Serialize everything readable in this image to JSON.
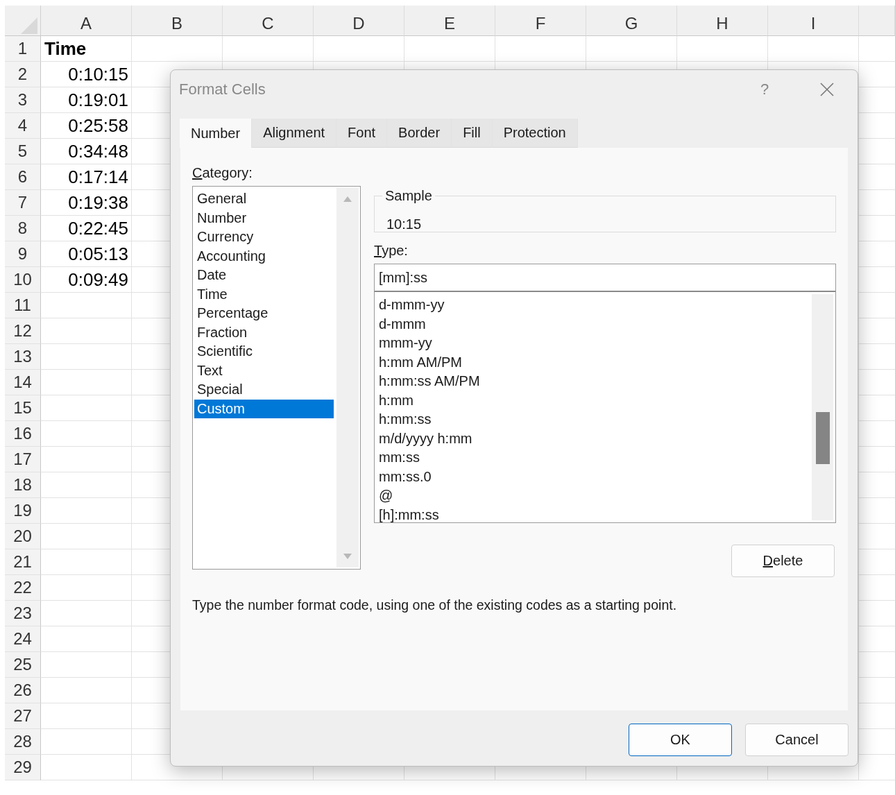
{
  "sheet": {
    "columns": [
      "A",
      "B",
      "C",
      "D",
      "E",
      "F",
      "G",
      "H",
      "I"
    ],
    "rows": [
      {
        "number": "1",
        "cell_a": {
          "text": "Time",
          "bold": true
        }
      },
      {
        "number": "2",
        "cell_a": {
          "text": "0:10:15",
          "bold": false
        }
      },
      {
        "number": "3",
        "cell_a": {
          "text": "0:19:01",
          "bold": false
        }
      },
      {
        "number": "4",
        "cell_a": {
          "text": "0:25:58",
          "bold": false
        }
      },
      {
        "number": "5",
        "cell_a": {
          "text": "0:34:48",
          "bold": false
        }
      },
      {
        "number": "6",
        "cell_a": {
          "text": "0:17:14",
          "bold": false
        }
      },
      {
        "number": "7",
        "cell_a": {
          "text": "0:19:38",
          "bold": false
        }
      },
      {
        "number": "8",
        "cell_a": {
          "text": "0:22:45",
          "bold": false
        }
      },
      {
        "number": "9",
        "cell_a": {
          "text": "0:05:13",
          "bold": false
        }
      },
      {
        "number": "10",
        "cell_a": {
          "text": "0:09:49",
          "bold": false
        }
      },
      {
        "number": "11"
      },
      {
        "number": "12"
      },
      {
        "number": "13"
      },
      {
        "number": "14"
      },
      {
        "number": "15"
      },
      {
        "number": "16"
      },
      {
        "number": "17"
      },
      {
        "number": "18"
      },
      {
        "number": "19"
      },
      {
        "number": "20"
      },
      {
        "number": "21"
      },
      {
        "number": "22"
      },
      {
        "number": "23"
      },
      {
        "number": "24"
      },
      {
        "number": "25"
      },
      {
        "number": "26"
      },
      {
        "number": "27"
      },
      {
        "number": "28"
      },
      {
        "number": "29"
      }
    ]
  },
  "dialog": {
    "title": "Format Cells",
    "help": "?",
    "tabs": [
      {
        "label": "Number",
        "selected": true
      },
      {
        "label": "Alignment",
        "selected": false
      },
      {
        "label": "Font",
        "selected": false
      },
      {
        "label": "Border",
        "selected": false
      },
      {
        "label": "Fill",
        "selected": false
      },
      {
        "label": "Protection",
        "selected": false
      }
    ],
    "category": {
      "label": "Category:",
      "items": [
        {
          "label": "General",
          "selected": false
        },
        {
          "label": "Number",
          "selected": false
        },
        {
          "label": "Currency",
          "selected": false
        },
        {
          "label": "Accounting",
          "selected": false
        },
        {
          "label": "Date",
          "selected": false
        },
        {
          "label": "Time",
          "selected": false
        },
        {
          "label": "Percentage",
          "selected": false
        },
        {
          "label": "Fraction",
          "selected": false
        },
        {
          "label": "Scientific",
          "selected": false
        },
        {
          "label": "Text",
          "selected": false
        },
        {
          "label": "Special",
          "selected": false
        },
        {
          "label": "Custom",
          "selected": true
        }
      ]
    },
    "sample": {
      "legend": "Sample",
      "value": "10:15"
    },
    "type": {
      "label": "Type:",
      "value": "[mm]:ss",
      "items": [
        {
          "label": "d-mmm-yy",
          "selected": false
        },
        {
          "label": "d-mmm",
          "selected": false
        },
        {
          "label": "mmm-yy",
          "selected": false
        },
        {
          "label": "h:mm AM/PM",
          "selected": false
        },
        {
          "label": "h:mm:ss AM/PM",
          "selected": false
        },
        {
          "label": "h:mm",
          "selected": false
        },
        {
          "label": "h:mm:ss",
          "selected": false
        },
        {
          "label": "m/d/yyyy h:mm",
          "selected": false
        },
        {
          "label": "mm:ss",
          "selected": false
        },
        {
          "label": "mm:ss.0",
          "selected": false
        },
        {
          "label": "@",
          "selected": false
        },
        {
          "label": "[h]:mm:ss",
          "selected": false
        }
      ]
    },
    "delete_button": "Delete",
    "description": "Type the number format code, using one of the existing codes as a starting point.",
    "buttons": [
      {
        "label": "OK",
        "default": true
      },
      {
        "label": "Cancel",
        "default": false
      }
    ]
  }
}
